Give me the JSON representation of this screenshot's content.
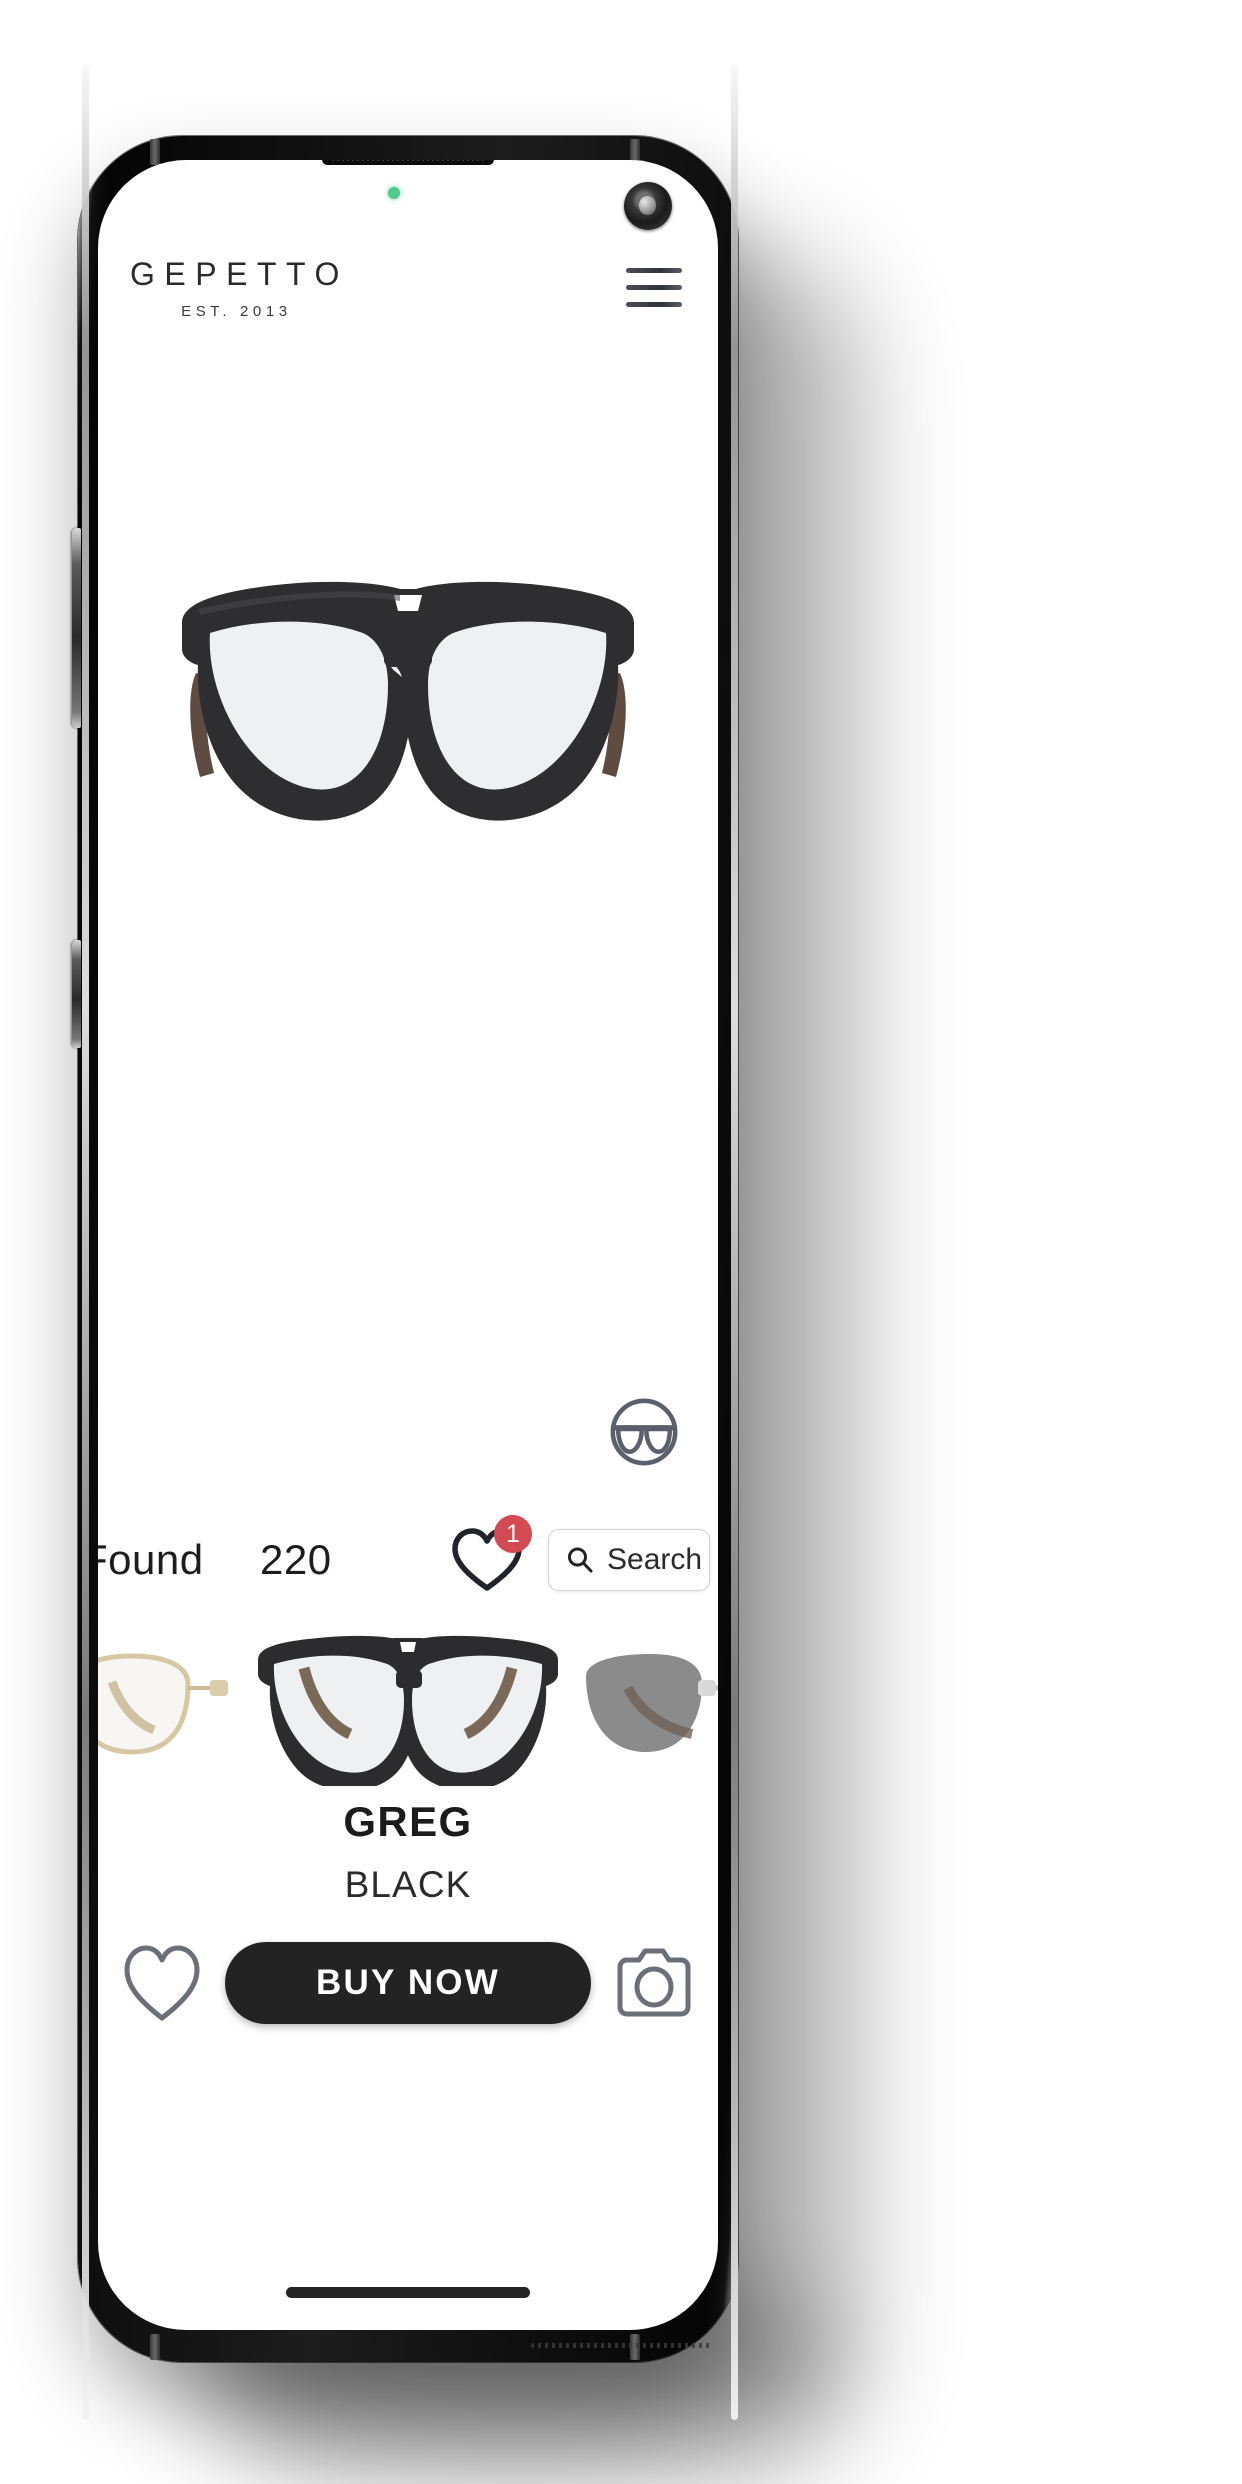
{
  "device": {
    "earpiece_icon": "speaker-grille",
    "front_camera_icon": "front-camera",
    "status_led_color": "#4ecb8a",
    "home_indicator": "home-indicator"
  },
  "header": {
    "brand_name": "GEPETTO",
    "established": "EST. 2013",
    "menu_icon": "hamburger-menu-icon"
  },
  "hero": {
    "icon": "aviator-eyeglasses-hero",
    "frame_color": "#2e2e30",
    "lens_color": "#f1f2f3"
  },
  "tryon": {
    "icon": "face-with-glasses-icon",
    "color": "#5a5f6b"
  },
  "results": {
    "found_label": "Found",
    "count": "220",
    "favorites_icon": "heart-outline-icon",
    "favorites_badge": "1",
    "badge_color": "#d24a52"
  },
  "search": {
    "icon": "search-icon",
    "placeholder": "Search",
    "value": "Search"
  },
  "carousel": {
    "items": [
      {
        "name": "gold-wire-frames",
        "frame_color": "#d9cba6",
        "lens_color": "#f6f5f1",
        "position": "previous"
      },
      {
        "name": "black-aviator-frames",
        "frame_color": "#2c2c2e",
        "lens_color": "#f0f1f2",
        "position": "active"
      },
      {
        "name": "gray-tinted-rimless",
        "frame_color": "#8a8a8a",
        "lens_color": "#8c8c8c",
        "position": "next"
      }
    ]
  },
  "product": {
    "name": "GREG",
    "color": "BLACK"
  },
  "actions": {
    "favorite_icon": "heart-outline-icon",
    "buy_label": "BUY NOW",
    "camera_icon": "camera-icon"
  }
}
